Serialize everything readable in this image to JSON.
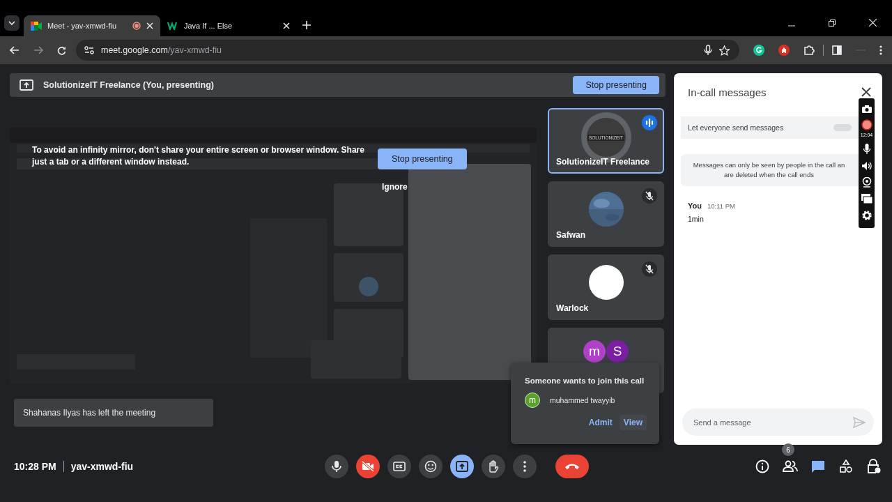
{
  "browser": {
    "tabs": [
      {
        "title": "Meet - yav-xmwd-fiu",
        "selected": true,
        "kind": "meet",
        "recording": true
      },
      {
        "title": "Java If ... Else",
        "selected": false,
        "kind": "w3",
        "recording": false
      }
    ],
    "url": {
      "host": "meet.google.com",
      "path": "/yav-xmwd-fiu"
    }
  },
  "presenting_bar": {
    "label": "SolutionizeIT Freelance (You, presenting)",
    "button": "Stop presenting"
  },
  "mirror_warning": {
    "text": "To avoid an infinity mirror, don't share your entire screen or browser window. Share just a tab or a different window instead.",
    "stop_button": "Stop presenting",
    "ignore_button": "Ignore"
  },
  "tiles": [
    {
      "name": "SolutionizeIT Freelance",
      "kind": "logo",
      "logo_text": "SOLUTIONIZEIT",
      "selected": true,
      "speaking": true,
      "muted": false
    },
    {
      "name": "Safwan",
      "selected": false,
      "speaking": false,
      "muted": true
    },
    {
      "name": "Warlock",
      "kind": "plain",
      "selected": false,
      "speaking": false,
      "muted": true
    },
    {
      "kind": "group",
      "selected": false,
      "speaking": false,
      "muted": false,
      "avatars": [
        {
          "letter": "m",
          "color": "#b140c8"
        },
        {
          "letter": "S",
          "color": "#7b1fa2"
        }
      ]
    }
  ],
  "toast": "Shahanas Ilyas has left the meeting",
  "join_request": {
    "title": "Someone wants to join this call",
    "name": "muhammed twayyib",
    "initial": "m",
    "color": "#5aa02c",
    "admit": "Admit",
    "view": "View"
  },
  "bottom_bar": {
    "time": "10:28 PM",
    "meeting_code": "yav-xmwd-fiu",
    "controls": [
      {
        "kind": "mic",
        "off": false,
        "active": false
      },
      {
        "kind": "camera",
        "off": true,
        "active": false
      },
      {
        "kind": "captions",
        "off": false,
        "active": false
      },
      {
        "kind": "emoji",
        "off": false,
        "active": false
      },
      {
        "kind": "present",
        "off": false,
        "active": true
      },
      {
        "kind": "hand",
        "off": false,
        "active": false
      },
      {
        "kind": "more",
        "off": false,
        "active": false
      },
      {
        "kind": "end"
      }
    ],
    "side_buttons": [
      {
        "kind": "info",
        "selected": false
      },
      {
        "kind": "people",
        "selected": false,
        "badge": "6"
      },
      {
        "kind": "chat",
        "selected": true
      },
      {
        "kind": "activities",
        "selected": false
      },
      {
        "kind": "host",
        "selected": false
      }
    ]
  },
  "chat": {
    "title": "In-call messages",
    "setting": {
      "label": "Let everyone send messages",
      "on": false
    },
    "notice_lines": [
      "Messages can only be seen by people in the call an",
      "are deleted when the call ends"
    ],
    "messages": [
      {
        "sender": "You",
        "time": "10:11 PM",
        "text": "1min"
      }
    ],
    "input": {
      "placeholder": "Send a message"
    }
  },
  "recorder_toolbar": {
    "timer": "12:04"
  }
}
